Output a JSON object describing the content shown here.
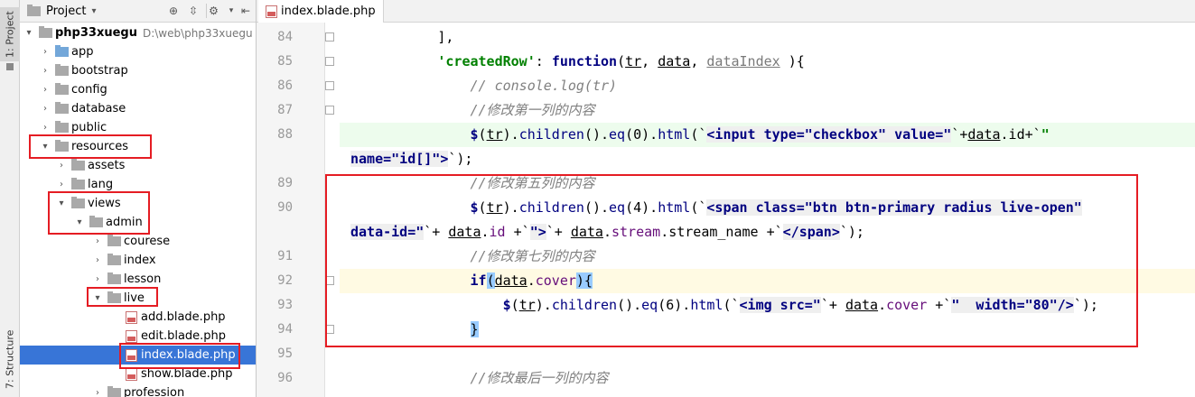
{
  "tool_strip": {
    "project_tab": "1: Project",
    "structure_tab": "7: Structure"
  },
  "project_panel": {
    "title": "Project",
    "tree": [
      {
        "label": "php33xuegu",
        "path": "D:\\web\\php33xuegu",
        "expanded": true
      },
      {
        "label": "app"
      },
      {
        "label": "bootstrap"
      },
      {
        "label": "config"
      },
      {
        "label": "database"
      },
      {
        "label": "public"
      },
      {
        "label": "resources",
        "expanded": true
      },
      {
        "label": "assets"
      },
      {
        "label": "lang"
      },
      {
        "label": "views",
        "expanded": true
      },
      {
        "label": "admin",
        "expanded": true
      },
      {
        "label": "courese"
      },
      {
        "label": "index"
      },
      {
        "label": "lesson"
      },
      {
        "label": "live",
        "expanded": true
      },
      {
        "label": "add.blade.php"
      },
      {
        "label": "edit.blade.php"
      },
      {
        "label": "index.blade.php",
        "selected": true
      },
      {
        "label": "show.blade.php"
      },
      {
        "label": "profession"
      }
    ]
  },
  "editor": {
    "tab_label": "index.blade.php",
    "line_numbers": [
      "84",
      "85",
      "86",
      "87",
      "88",
      "89",
      "90",
      "91",
      "92",
      "93",
      "94",
      "95",
      "96"
    ],
    "lines": [
      [
        "],"
      ],
      [
        "'createdRow'",
        ": ",
        "function",
        "(",
        "tr",
        ", ",
        "data",
        ", ",
        "dataIndex",
        " ){"
      ],
      [
        "// console.log(tr)"
      ],
      [
        "//修改第一列的内容"
      ],
      [
        "$",
        "(",
        "tr",
        ").",
        "children",
        "().",
        "eq",
        "(0).",
        "html",
        "(`",
        "<input type=\"checkbox\" value=\"",
        "`+",
        "data",
        ".id+`",
        "\""
      ],
      [
        "name=\"id[]\">",
        "`);"
      ],
      [
        "//修改第五列的内容"
      ],
      [
        "$",
        "(",
        "tr",
        ").",
        "children",
        "().",
        "eq",
        "(4).",
        "html",
        "(`",
        "<span class=\"btn btn-primary radius live-open\""
      ],
      [
        "data-id=\"",
        "`+ ",
        "data",
        ".",
        "id",
        " +`",
        "\">",
        "`+ ",
        "data",
        ".",
        "stream",
        ".",
        "stream_name",
        " +`",
        "</span>",
        "`);"
      ],
      [
        "//修改第七列的内容"
      ],
      [
        "if",
        "(",
        "data",
        ".",
        "cover",
        "){"
      ],
      [
        "$",
        "(",
        "tr",
        ").",
        "children",
        "().",
        "eq",
        "(6).",
        "html",
        "(`",
        "<img src=\"",
        "`+ ",
        "data",
        ".",
        "cover",
        " +`",
        "\"  width=\"80\"/>",
        "`);"
      ],
      [
        "}"
      ],
      [
        ""
      ],
      [
        "//修改最后一列的内容"
      ]
    ]
  }
}
